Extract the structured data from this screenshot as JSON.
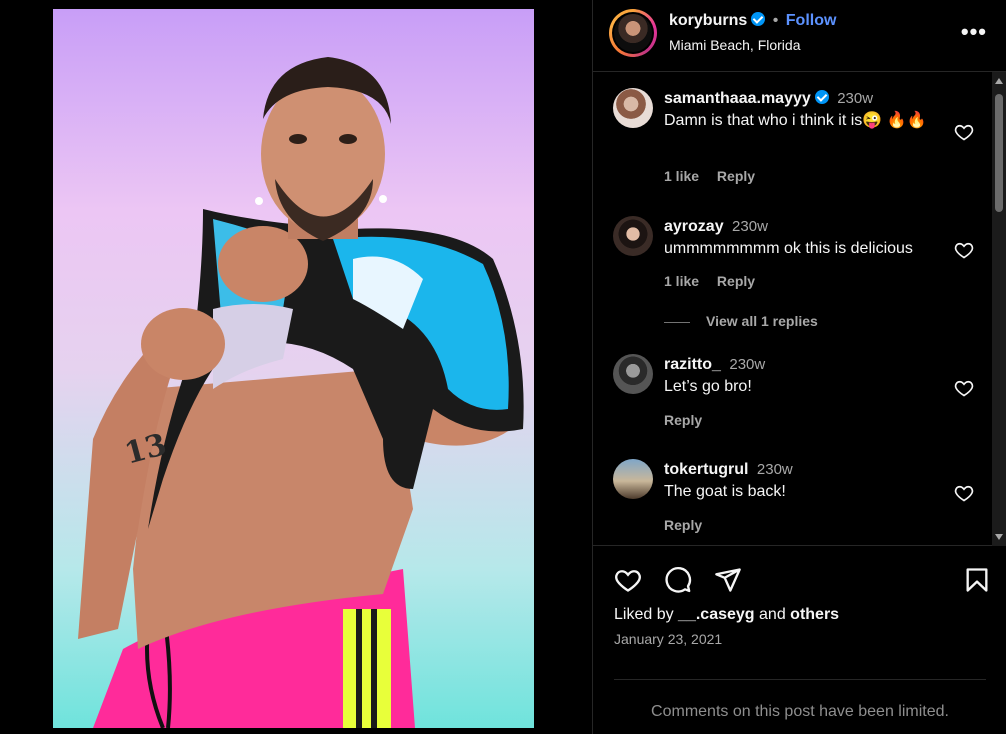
{
  "post": {
    "username": "koryburns",
    "verified": true,
    "follow_label": "Follow",
    "separator": "•",
    "location": "Miami Beach, Florida",
    "more_label": "•••"
  },
  "comments": [
    {
      "username": "samanthaaa.mayyy",
      "verified": true,
      "time": "230w",
      "text": "Damn is that who i think it is😜 🔥🔥",
      "likes": "1 like",
      "reply_label": "Reply"
    },
    {
      "username": "ayrozay",
      "verified": false,
      "time": "230w",
      "text": "ummmmmmmm ok this is delicious",
      "likes": "1 like",
      "reply_label": "Reply",
      "view_replies": "View all 1 replies"
    },
    {
      "username": "razitto_",
      "verified": false,
      "time": "230w",
      "text": "Let’s go bro!",
      "reply_label": "Reply"
    },
    {
      "username": "tokertugrul",
      "verified": false,
      "time": "230w",
      "text": "The goat is back!",
      "reply_label": "Reply"
    }
  ],
  "footer": {
    "liked_prefix": "Liked by",
    "liked_user": "__.caseyg",
    "liked_and": "and",
    "liked_others": "others",
    "date": "January 23, 2021",
    "limited_notice": "Comments on this post have been limited."
  },
  "icons": [
    "heart-icon",
    "comment-icon",
    "share-icon",
    "bookmark-icon",
    "verified-icon",
    "more-options-icon"
  ],
  "colors": {
    "background": "#000000",
    "accent": "#0095f6",
    "follow": "#5c92ff",
    "muted": "#a8a8a8"
  }
}
